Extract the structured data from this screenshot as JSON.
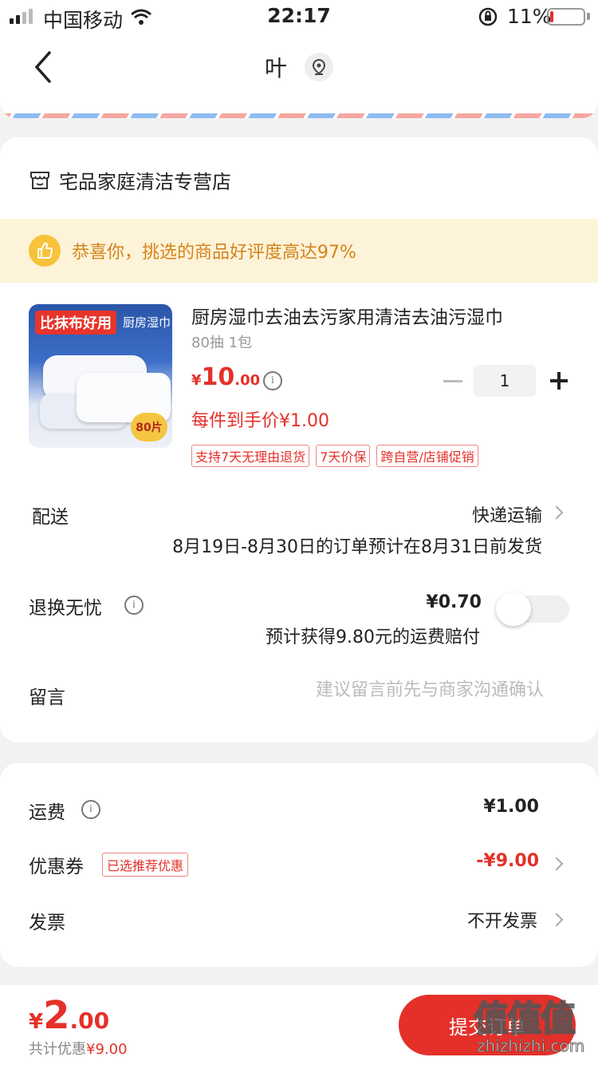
{
  "status_bar": {
    "carrier": "中国移动",
    "time": "22:17",
    "battery": "11%",
    "battery_level": 0.11,
    "battery_color": "#e5302a"
  },
  "nav": {
    "title": "叶",
    "back_icon": "chevron-left-icon",
    "location_icon": "location-pin-icon"
  },
  "shop": {
    "name": "宅品家庭清洁专营店",
    "icon": "shop-icon"
  },
  "banner": {
    "text": "恭喜你，挑选的商品好评度高达97%"
  },
  "product": {
    "thumb_badge": "比抹布好用",
    "thumb_title": "厨房湿巾",
    "thumb_count": "80片",
    "title": "厨房湿巾去油去污家用清洁去油污湿巾",
    "spec": "80抽 1包",
    "price_symbol": "¥",
    "price_int": "10",
    "price_dec": ".00",
    "quantity": "1",
    "each_price": "每件到手价¥1.00",
    "tags": [
      "支持7天无理由退货",
      "7天价保",
      "跨自营/店铺促销"
    ]
  },
  "delivery": {
    "label": "配送",
    "value": "快递运输",
    "note": "8月19日-8月30日的订单预计在8月31日前发货"
  },
  "return_insurance": {
    "label": "退换无忧",
    "price": "¥0.70",
    "note": "预计获得9.80元的运费赔付",
    "enabled": false
  },
  "message": {
    "label": "留言",
    "placeholder": "建议留言前先与商家沟通确认"
  },
  "fees": {
    "shipping_label": "运费",
    "shipping_value": "¥1.00",
    "coupon_label": "优惠券",
    "coupon_tag": "已选推荐优惠",
    "coupon_value": "-¥9.00",
    "invoice_label": "发票",
    "invoice_value": "不开发票"
  },
  "bottom": {
    "total_symbol": "¥",
    "total_int": "2",
    "total_dec": ".00",
    "saved_label": "共计优惠",
    "saved_value": "¥9.00",
    "submit_label": "提交订单"
  },
  "watermark": {
    "main": "值值值",
    "sub": "zhizhizhi.com"
  },
  "colors": {
    "accent": "#e5302a",
    "banner_bg": "#fdf3d9",
    "banner_text": "#d4831b"
  }
}
